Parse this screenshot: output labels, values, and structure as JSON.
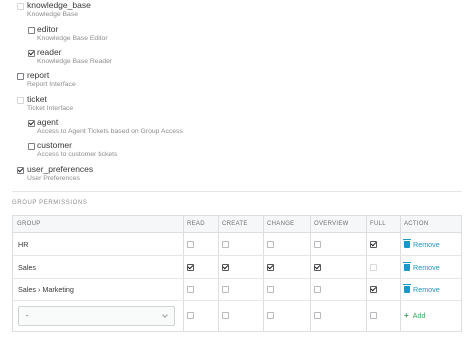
{
  "roles": [
    {
      "name": "knowledge_base",
      "desc": "Knowledge Base",
      "checked": false,
      "disabled": true
    },
    {
      "name": "editor",
      "desc": "Knowledge Base Editor",
      "checked": false,
      "disabled": false
    },
    {
      "name": "reader",
      "desc": "Knowledge Base Reader",
      "checked": true,
      "disabled": false
    },
    {
      "name": "report",
      "desc": "Report Interface",
      "checked": false,
      "disabled": false
    },
    {
      "name": "ticket",
      "desc": "Ticket Interface",
      "checked": false,
      "disabled": true
    },
    {
      "name": "agent",
      "desc": "Access to Agent Tickets based on Group Access",
      "checked": true,
      "disabled": false
    },
    {
      "name": "customer",
      "desc": "Access to customer tickets",
      "checked": false,
      "disabled": false
    },
    {
      "name": "user_preferences",
      "desc": "User Preferences",
      "checked": true,
      "disabled": false
    }
  ],
  "group_permissions": {
    "title": "GROUP PERMISSIONS",
    "headers": {
      "group": "GROUP",
      "read": "READ",
      "create": "CREATE",
      "change": "CHANGE",
      "overview": "OVERVIEW",
      "full": "FULL",
      "action": "ACTION"
    },
    "rows": [
      {
        "group": "HR",
        "read": false,
        "create": false,
        "change": false,
        "overview": false,
        "full": true,
        "action": "Remove"
      },
      {
        "group": "Sales",
        "read": true,
        "create": true,
        "change": true,
        "overview": true,
        "full": false,
        "action": "Remove"
      },
      {
        "group": "Sales › Marketing",
        "read": false,
        "create": false,
        "change": false,
        "overview": false,
        "full": true,
        "action": "Remove"
      }
    ],
    "new_row": {
      "select_value": "-",
      "action": "Add"
    }
  },
  "colors": {
    "link": "#1d97c6",
    "add": "#3aa85c"
  },
  "icons": {
    "remove": "trash-icon",
    "add": "plus-icon",
    "select": "chevron-down-icon"
  }
}
